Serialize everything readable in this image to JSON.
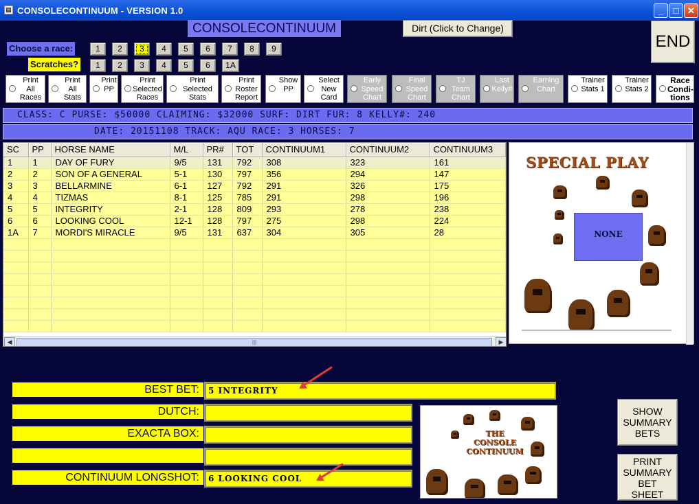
{
  "window": {
    "title": "CONSOLECONTINUUM - VERSION 1.0",
    "app_icon": "doc-icon",
    "minimize_glyph": "_",
    "maximize_glyph": "□",
    "close_glyph": "✕"
  },
  "headline": "CONSOLECONTINUUM !!",
  "surface_button": "Dirt (Click to Change)",
  "end_button": "END",
  "race_chooser": {
    "label": "Choose  a race:",
    "races": [
      "1",
      "2",
      "3",
      "4",
      "5",
      "6",
      "7",
      "8",
      "9"
    ],
    "selected": "3"
  },
  "scratches": {
    "label": "Scratches?",
    "items": [
      "1",
      "2",
      "3",
      "4",
      "5",
      "6",
      "1A"
    ]
  },
  "options": [
    {
      "label": "Print\nAll\nRaces",
      "style": "white"
    },
    {
      "label": "Print\nAll\nStats",
      "style": "white"
    },
    {
      "label": "Print\nPP",
      "style": "white"
    },
    {
      "label": "Print\nSelected\nRaces",
      "style": "white"
    },
    {
      "label": "Print\nSelected\nStats",
      "style": "white"
    },
    {
      "label": "Print\nRoster\nReport",
      "style": "white"
    },
    {
      "label": "Show\nPP",
      "style": "white"
    },
    {
      "label": "Select\nNew\nCard",
      "style": "white"
    },
    {
      "label": "Early\nSpeed\nChart",
      "style": "grey"
    },
    {
      "label": "Final\nSpeed\nChart",
      "style": "grey"
    },
    {
      "label": "TJ\nTeam\nChart",
      "style": "grey"
    },
    {
      "label": "Last\nKelly#",
      "style": "grey"
    },
    {
      "label": "Earning\nChart",
      "style": "grey"
    },
    {
      "label": "Trainer\nStats 1",
      "style": "white"
    },
    {
      "label": "Trainer\nStats 2",
      "style": "white"
    },
    {
      "label": "Race\nCondi-\ntions",
      "style": "bold"
    }
  ],
  "race_info": {
    "line1": "CLASS: C    PURSE: $50000   CLAIMING: $32000    SURF: DIRT     FUR: 8   KELLY#: 240",
    "line2": "DATE: 20151108    TRACK: AQU     RACE: 3    HORSES: 7"
  },
  "grid": {
    "columns": [
      "SC",
      "PP",
      "HORSE NAME",
      "M/L",
      "PR#",
      "TOT",
      "CONTINUUM1",
      "CONTINUUM2",
      "CONTINUUM3"
    ],
    "rows": [
      [
        "1",
        "1",
        "DAY OF FURY",
        "9/5",
        "131",
        "792",
        "308",
        "323",
        "161"
      ],
      [
        "2",
        "2",
        "SON OF A GENERAL",
        "5-1",
        "130",
        "797",
        "356",
        "294",
        "147"
      ],
      [
        "3",
        "3",
        "BELLARMINE",
        "6-1",
        "127",
        "792",
        "291",
        "326",
        "175"
      ],
      [
        "4",
        "4",
        "TIZMAS",
        "8-1",
        "125",
        "785",
        "291",
        "298",
        "196"
      ],
      [
        "5",
        "5",
        "INTEGRITY",
        "2-1",
        "128",
        "809",
        "293",
        "278",
        "238"
      ],
      [
        "6",
        "6",
        "LOOKING COOL",
        "12-1",
        "128",
        "797",
        "275",
        "298",
        "224"
      ],
      [
        "1A",
        "7",
        "MORDI'S MIRACLE",
        "9/5",
        "131",
        "637",
        "304",
        "305",
        "28"
      ]
    ],
    "empty_rows": 8,
    "scroll_left": "◀",
    "scroll_right": "▶",
    "scroll_grip": "|||"
  },
  "special_play": {
    "title": "SPECIAL PLAY",
    "value": "NONE"
  },
  "bets": {
    "best_bet_label": "BEST BET:",
    "best_bet_value": "5  INTEGRITY",
    "dutch_label": "DUTCH:",
    "dutch_value": "",
    "exacta_label": "EXACTA BOX:",
    "exacta_value": "",
    "blank_label": "",
    "blank_value": "",
    "longshot_label": "CONTINUUM LONGSHOT:",
    "longshot_value": "6   LOOKING  COOL"
  },
  "logo_text": "THE\nCONSOLE\nCONTINUUM",
  "show_summary_button": "SHOW\nSUMMARY\nBETS",
  "print_summary_button": "PRINT\nSUMMARY\nBET\nSHEET",
  "colors": {
    "background": "#06063a",
    "accent_blue": "#6f6ff2",
    "field_yellow": "#ffff00",
    "grid_yellow": "#ffff99",
    "horse_brown": "#6b3a12",
    "annotation_red": "#e33a3a"
  }
}
